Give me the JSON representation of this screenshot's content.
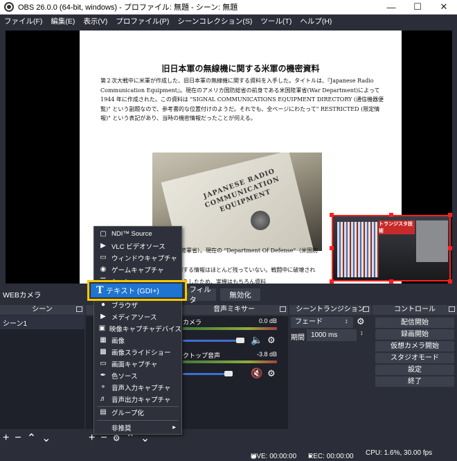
{
  "window": {
    "title": "OBS 26.0.0 (64-bit, windows) - プロファイル: 無題 - シーン: 無題"
  },
  "menu": [
    "ファイル(F)",
    "編集(E)",
    "表示(V)",
    "プロファイル(P)",
    "シーンコレクション(S)",
    "ツール(T)",
    "ヘルプ(H)"
  ],
  "document": {
    "title": "旧日本軍の無線機に関する米軍の機密資料",
    "paragraph": "第２次大戦中に米軍が作成した、旧日本軍の無線機に関する資料を入手した。タイトルは、『Japanese Radio Communication Equipment』。現在のアメリカ国防総省の前身である米国陸軍省(War Department)によって1944 年に作成された。この資料は \"SIGNAL COMMUNICATIONS EQUIPMENT DIRECTORY (通信機器便覧)\" という副題なので、参考書的な位置付けのようだ。それでも、全ページにわたって\" RESTRICTED (限定情報)\" という表記があり、当時の機密情報だったことが伺える。",
    "photo_text": "JAPANESE RADIO COMMUNICATION EQUIPMENT",
    "tail1": "nt\"（旧陸軍省）。現在の \"Department Of Defense\"（米国防",
    "tail2": "に関する情報はほとんど残っていない。戦闘中に破壊され",
    "tail3": "ったりしたため、実機はもちろん資料"
  },
  "webcam": {
    "poster": "トランジスタ技術"
  },
  "source_bar": {
    "source_name": "WEBカメラ",
    "filter_label": "フィルタ",
    "deactivate_label": "無効化"
  },
  "docks": {
    "scenes": {
      "header": "シーン",
      "items": [
        "シーン1"
      ]
    },
    "mixer": {
      "header": "音声ミキサー",
      "channels": [
        {
          "name": "カメラ",
          "level": "0.0 dB",
          "volume": 0.92,
          "muted": false
        },
        {
          "name": "クトップ音声",
          "level": "-3.8 dB",
          "volume": 0.73,
          "muted": true
        }
      ]
    },
    "transitions": {
      "header": "シーントランジション",
      "selected": "フェード",
      "duration_label": "期間",
      "duration_value": "1000 ms"
    },
    "controls": {
      "header": "コントロール",
      "buttons": [
        "配信開始",
        "録画開始",
        "仮想カメラ開始",
        "スタジオモード",
        "設定",
        "終了"
      ]
    }
  },
  "context_menu": {
    "items": [
      {
        "label": "NDI™ Source",
        "icon": "ndi-icon"
      },
      {
        "label": "VLC ビデオソース",
        "icon": "play-icon"
      },
      {
        "label": "ウィンドウキャプチャ",
        "icon": "window-icon"
      },
      {
        "label": "ゲームキャプチャ",
        "icon": "gamepad-icon"
      },
      {
        "label": "シーン",
        "icon": "list-icon"
      },
      {
        "label": "テキスト (GDI+)",
        "icon": "text-icon"
      },
      {
        "label": "ブラウザ",
        "icon": "globe-icon"
      },
      {
        "label": "メディアソース",
        "icon": "play-icon"
      },
      {
        "label": "映像キャプチャデバイス",
        "icon": "camera-icon"
      },
      {
        "label": "画像",
        "icon": "image-icon"
      },
      {
        "label": "画像スライドショー",
        "icon": "slideshow-icon"
      },
      {
        "label": "画面キャプチャ",
        "icon": "monitor-icon"
      },
      {
        "label": "色ソース",
        "icon": "brush-icon"
      },
      {
        "label": "音声入力キャプチャ",
        "icon": "microphone-icon"
      },
      {
        "label": "音声出力キャプチャ",
        "icon": "speaker-icon"
      },
      {
        "label": "グループ化",
        "icon": "folder-icon"
      },
      {
        "label": "非推奨",
        "icon": ""
      }
    ]
  },
  "status": {
    "live": "LIVE: 00:00:00",
    "rec": "REC: 00:00:00",
    "cpu": "CPU: 1.6%, 30.00 fps"
  },
  "colors": {
    "background": "#2b2e38",
    "selection": "#1e74d0",
    "highlight_border": "#f5c800",
    "transform_handles": "#ff1f1f"
  }
}
